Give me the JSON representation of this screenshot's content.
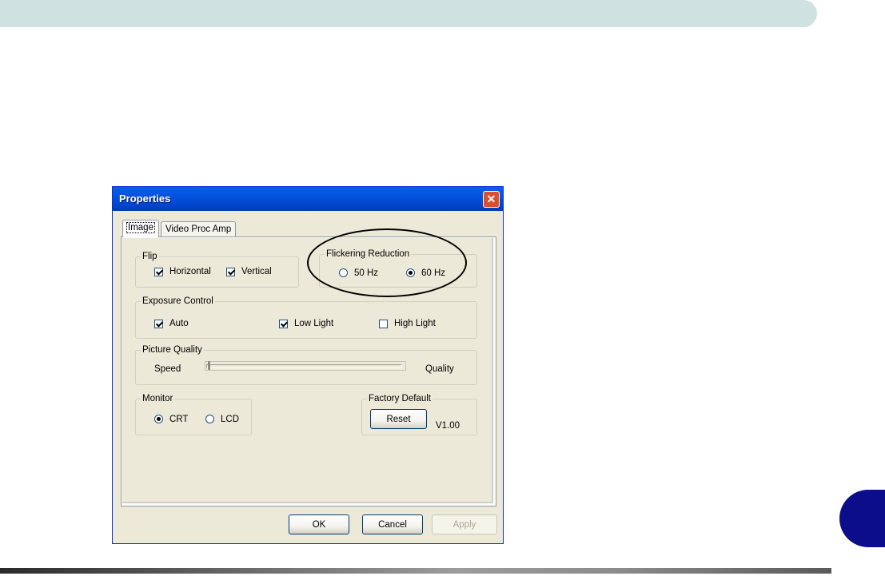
{
  "dialog": {
    "title": "Properties",
    "close_glyph": "✕",
    "tabs": [
      {
        "label": "Image",
        "active": true
      },
      {
        "label": "Video Proc Amp",
        "active": false
      }
    ],
    "flip": {
      "legend": "Flip",
      "horizontal": {
        "label": "Horizontal",
        "checked": true
      },
      "vertical": {
        "label": "Vertical",
        "checked": true
      }
    },
    "flicker": {
      "legend": "Flickering Reduction",
      "hz50": {
        "label": "50 Hz",
        "selected": false
      },
      "hz60": {
        "label": "60 Hz",
        "selected": true
      }
    },
    "exposure": {
      "legend": "Exposure Control",
      "auto": {
        "label": "Auto",
        "checked": true
      },
      "low_light": {
        "label": "Low Light",
        "checked": true
      },
      "high_light": {
        "label": "High Light",
        "checked": false
      }
    },
    "quality": {
      "legend": "Picture Quality",
      "left_label": "Speed",
      "right_label": "Quality",
      "slider_position": 0.0
    },
    "monitor": {
      "legend": "Monitor",
      "crt": {
        "label": "CRT",
        "selected": true
      },
      "lcd": {
        "label": "LCD",
        "selected": false
      }
    },
    "factory": {
      "legend": "Factory Default",
      "reset_label": "Reset",
      "version": "V1.00"
    },
    "buttons": {
      "ok": "OK",
      "cancel": "Cancel",
      "apply": "Apply"
    }
  },
  "colors": {
    "header_bar": "#cfe1e0",
    "page_tab": "#0b0d8a",
    "dialog_bg": "#ece9d8",
    "titlebar": "#0453de"
  }
}
